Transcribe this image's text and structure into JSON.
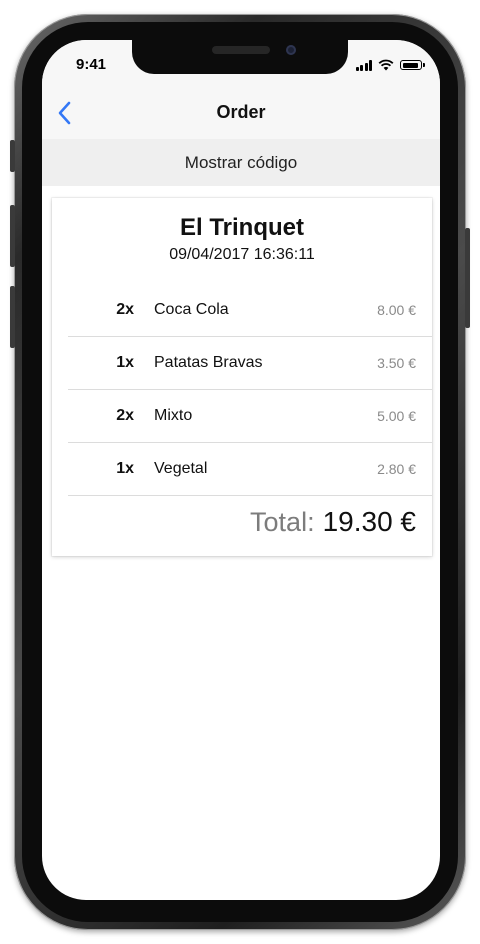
{
  "status_bar": {
    "time": "9:41"
  },
  "nav": {
    "title": "Order",
    "back_icon": "chevron-left-icon",
    "accent": "#3478f6"
  },
  "code_bar": {
    "label": "Mostrar código"
  },
  "receipt": {
    "shop_name": "El Trinquet",
    "datetime": "09/04/2017 16:36:11",
    "items": [
      {
        "qty": "2x",
        "name": "Coca Cola",
        "price": "8.00 €"
      },
      {
        "qty": "1x",
        "name": "Patatas Bravas",
        "price": "3.50 €"
      },
      {
        "qty": "2x",
        "name": "Mixto",
        "price": "5.00 €"
      },
      {
        "qty": "1x",
        "name": "Vegetal",
        "price": "2.80 €"
      }
    ],
    "total_label": "Total:",
    "total_value": "19.30 €"
  }
}
